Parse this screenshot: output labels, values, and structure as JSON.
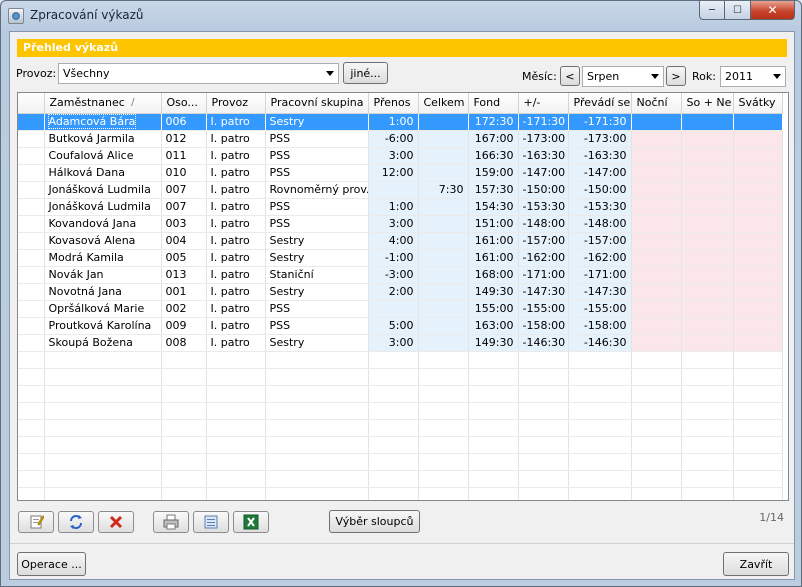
{
  "window": {
    "title": "Zpracování výkazů"
  },
  "band": {
    "title": "Přehled výkazů"
  },
  "filters": {
    "provoz_label": "Provoz:",
    "provoz_value": "Všechny",
    "jine_label": "jiné...",
    "mesic_label": "Měsíc:",
    "mesic_value": "Srpen",
    "rok_label": "Rok:",
    "rok_value": "2011"
  },
  "table": {
    "columns": [
      "Zaměstnanec",
      "Oso...",
      "Provoz",
      "Pracovní skupina",
      "Přenos",
      "Celkem",
      "Fond",
      "+/-",
      "Převádí se",
      "Noční",
      "So + Ne",
      "Svátky"
    ],
    "rows": [
      [
        "Adamcová Bára",
        "006",
        "I. patro",
        "Sestry",
        "1:00",
        "",
        "172:30",
        "-171:30",
        "-171:30",
        "",
        "",
        ""
      ],
      [
        "Butková Jarmila",
        "012",
        "I. patro",
        "PSS",
        "-6:00",
        "",
        "167:00",
        "-173:00",
        "-173:00",
        "",
        "",
        ""
      ],
      [
        "Coufalová Alice",
        "011",
        "I. patro",
        "PSS",
        "3:00",
        "",
        "166:30",
        "-163:30",
        "-163:30",
        "",
        "",
        ""
      ],
      [
        "Hálková Dana",
        "010",
        "I. patro",
        "PSS",
        "12:00",
        "",
        "159:00",
        "-147:00",
        "-147:00",
        "",
        "",
        ""
      ],
      [
        "Jonášková Ludmila",
        "007",
        "I. patro",
        "Rovnoměrný prov...",
        "",
        "7:30",
        "157:30",
        "-150:00",
        "-150:00",
        "",
        "",
        ""
      ],
      [
        "Jonášková Ludmila",
        "007",
        "I. patro",
        "PSS",
        "1:00",
        "",
        "154:30",
        "-153:30",
        "-153:30",
        "",
        "",
        ""
      ],
      [
        "Kovandová Jana",
        "003",
        "I. patro",
        "PSS",
        "3:00",
        "",
        "151:00",
        "-148:00",
        "-148:00",
        "",
        "",
        ""
      ],
      [
        "Kovasová Alena",
        "004",
        "I. patro",
        "Sestry",
        "4:00",
        "",
        "161:00",
        "-157:00",
        "-157:00",
        "",
        "",
        ""
      ],
      [
        "Modrá Kamila",
        "005",
        "I. patro",
        "Sestry",
        "-1:00",
        "",
        "161:00",
        "-162:00",
        "-162:00",
        "",
        "",
        ""
      ],
      [
        "Novák Jan",
        "013",
        "I. patro",
        "Staniční",
        "-3:00",
        "",
        "168:00",
        "-171:00",
        "-171:00",
        "",
        "",
        ""
      ],
      [
        "Novotná Jana",
        "001",
        "I. patro",
        "Sestry",
        "2:00",
        "",
        "149:30",
        "-147:30",
        "-147:30",
        "",
        "",
        ""
      ],
      [
        "Opršálková Marie",
        "002",
        "I. patro",
        "PSS",
        "",
        "",
        "155:00",
        "-155:00",
        "-155:00",
        "",
        "",
        ""
      ],
      [
        "Proutková Karolína",
        "009",
        "I. patro",
        "PSS",
        "5:00",
        "",
        "163:00",
        "-158:00",
        "-158:00",
        "",
        "",
        ""
      ],
      [
        "Skoupá Božena",
        "008",
        "I. patro",
        "Sestry",
        "3:00",
        "",
        "149:30",
        "-146:30",
        "-146:30",
        "",
        "",
        ""
      ]
    ],
    "selected_row": 0,
    "empty_rows": 9
  },
  "toolbar": {
    "columns_button": "Výběr sloupců",
    "pager": "1/14"
  },
  "footer": {
    "operace": "Operace ...",
    "zavrit": "Zavřít"
  },
  "colors": {
    "band": "#fdc400",
    "selection": "#3399ff",
    "blue_cols": "#e5f1fb",
    "pink_cols": "#fbe7e9"
  }
}
